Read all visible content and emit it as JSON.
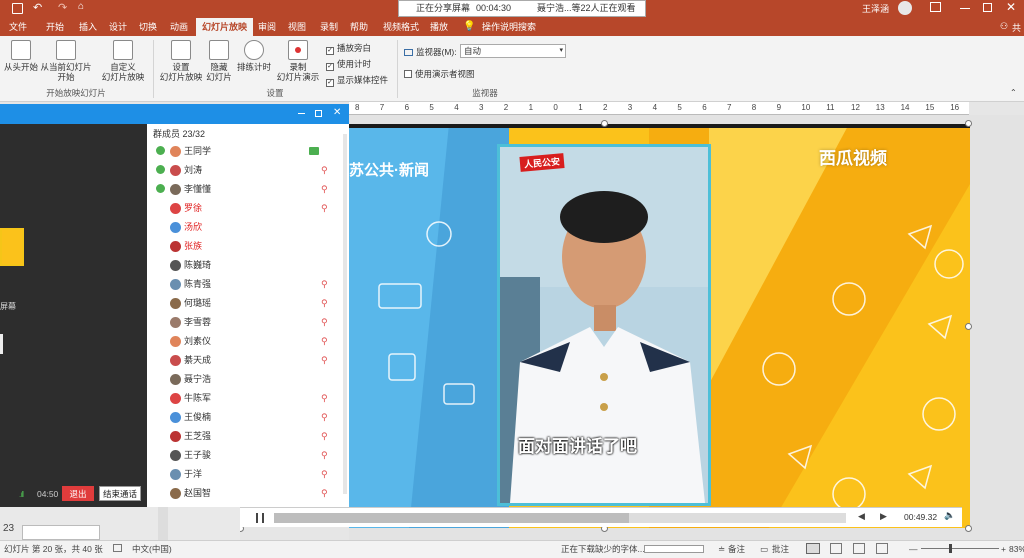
{
  "titlebar": {
    "user_name": "王泽涵"
  },
  "share_banner": {
    "status": "正在分享屏幕",
    "timer": "00:04:30",
    "viewers": "聂宁浩...等22人正在观看"
  },
  "tabs": [
    {
      "label": "文件"
    },
    {
      "label": "开始"
    },
    {
      "label": "插入"
    },
    {
      "label": "设计"
    },
    {
      "label": "切换"
    },
    {
      "label": "动画"
    },
    {
      "label": "幻灯片放映"
    },
    {
      "label": "审阅"
    },
    {
      "label": "视图"
    },
    {
      "label": "录制"
    },
    {
      "label": "帮助"
    },
    {
      "label": "视频格式"
    },
    {
      "label": "播放"
    },
    {
      "label": "操作说明搜索"
    }
  ],
  "share_label": "共",
  "ribbon": {
    "from_start": "从头开始",
    "from_current": "从当前幻灯片",
    "from_current_2": "开始",
    "custom": "自定义",
    "custom_2": "幻灯片放映",
    "group_start": "开始放映幻灯片",
    "setup": "设置",
    "setup_2": "幻灯片放映",
    "hide": "隐藏",
    "hide_2": "幻灯片",
    "rehearse": "排练计时",
    "record": "录制",
    "record_2": "幻灯片演示",
    "play_narration": "播放旁白",
    "use_timings": "使用计时",
    "show_media": "显示媒体控件",
    "group_setup": "设置",
    "monitor_label": "监视器(M):",
    "monitor_value": "自动",
    "presenter_view": "使用演示者视图",
    "group_monitor": "监视器"
  },
  "ruler_ticks": [
    "8",
    "7",
    "6",
    "5",
    "4",
    "3",
    "2",
    "1",
    "0",
    "1",
    "2",
    "3",
    "4",
    "5",
    "6",
    "7",
    "8",
    "9",
    "10",
    "11",
    "12",
    "13",
    "14",
    "15",
    "16"
  ],
  "chat": {
    "members_title": "群成员 23/32",
    "thumb_label": "屏幕",
    "timer": "04:50",
    "exit_label": "退出",
    "end_call_label": "结束通话",
    "members": [
      {
        "name": "王同学",
        "mic": "on",
        "color": "#333333"
      },
      {
        "name": "刘涛",
        "mic": "muted",
        "color": "#333333"
      },
      {
        "name": "李懂懂",
        "mic": "muted",
        "color": "#333333"
      },
      {
        "name": "罗徐",
        "mic": "muted",
        "color": "#e02020"
      },
      {
        "name": "汤欣",
        "mic": "none",
        "color": "#e02020"
      },
      {
        "name": "张族",
        "mic": "none",
        "color": "#e02020"
      },
      {
        "name": "陈巍琦",
        "mic": "none",
        "color": "#333333"
      },
      {
        "name": "陈青强",
        "mic": "muted",
        "color": "#333333"
      },
      {
        "name": "何璐瑶",
        "mic": "muted",
        "color": "#333333"
      },
      {
        "name": "李雪蓉",
        "mic": "muted",
        "color": "#333333"
      },
      {
        "name": "刘素仪",
        "mic": "muted",
        "color": "#333333"
      },
      {
        "name": "綦天成",
        "mic": "muted",
        "color": "#333333"
      },
      {
        "name": "聂宁浩",
        "mic": "none",
        "color": "#333333"
      },
      {
        "name": "牛陈军",
        "mic": "muted",
        "color": "#333333"
      },
      {
        "name": "王俊楠",
        "mic": "muted",
        "color": "#333333"
      },
      {
        "name": "王芝强",
        "mic": "muted",
        "color": "#333333"
      },
      {
        "name": "王子骏",
        "mic": "muted",
        "color": "#333333"
      },
      {
        "name": "于洋",
        "mic": "muted",
        "color": "#333333"
      },
      {
        "name": "赵国智",
        "mic": "muted",
        "color": "#333333"
      }
    ]
  },
  "slide": {
    "watermark_left": "苏公共·新闻",
    "logo_text": "人民公安",
    "watermark_right": "西瓜视频",
    "subtitle": "面对面讲话了吧"
  },
  "video_controls": {
    "time": "00:49.32"
  },
  "statusbar": {
    "slide_number": "23",
    "slide_info": "幻灯片 第 20 张，共 40 张",
    "language": "中文(中国)",
    "font_msg": "正在下载缺少的字体...",
    "notes": "备注",
    "comments": "批注",
    "zoom": "83%"
  },
  "colors": {
    "accent": "#b7472a",
    "chat_blue": "#1e8fe6",
    "slide_yellow": "#fbc21b",
    "slide_blue": "#59b7ea"
  }
}
